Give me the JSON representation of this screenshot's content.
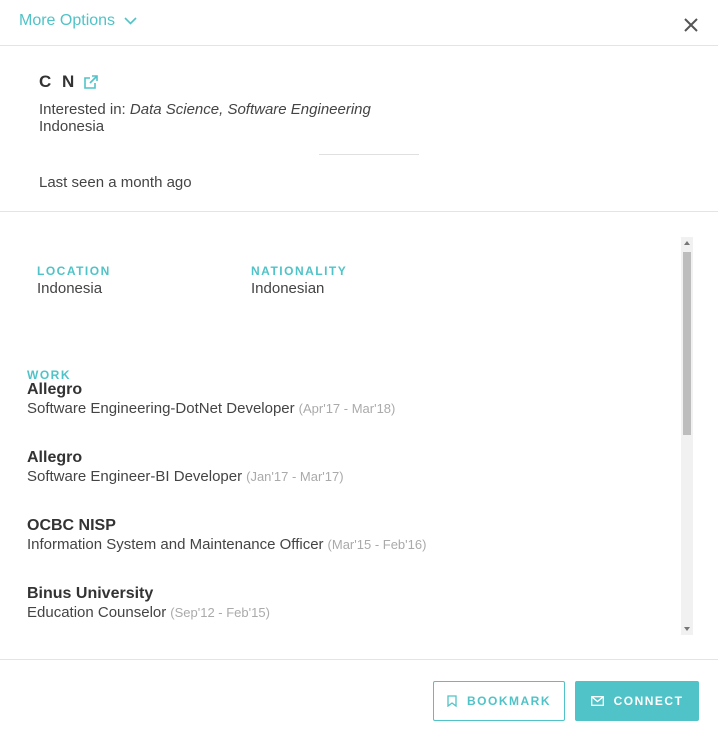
{
  "header": {
    "more_options_label": "More Options"
  },
  "profile": {
    "name": "C N",
    "interested_prefix": "Interested in:",
    "interests": "Data Science, Software Engineering",
    "country": "Indonesia",
    "last_seen": "Last seen a month ago"
  },
  "details": {
    "location_label": "LOCATION",
    "location_value": "Indonesia",
    "nationality_label": "NATIONALITY",
    "nationality_value": "Indonesian",
    "work_label": "WORK",
    "jobs": [
      {
        "company": "Allegro",
        "role": "Software Engineering-DotNet Developer",
        "dates": "(Apr'17 - Mar'18)"
      },
      {
        "company": "Allegro",
        "role": "Software Engineer-BI Developer",
        "dates": "(Jan'17 - Mar'17)"
      },
      {
        "company": "OCBC NISP",
        "role": "Information System and Maintenance Officer",
        "dates": "(Mar'15 - Feb'16)"
      },
      {
        "company": "Binus University",
        "role": "Education Counselor",
        "dates": "(Sep'12 - Feb'15)"
      }
    ]
  },
  "footer": {
    "bookmark_label": "BOOKMARK",
    "connect_label": "CONNECT"
  },
  "colors": {
    "accent": "#4fc3c7"
  }
}
